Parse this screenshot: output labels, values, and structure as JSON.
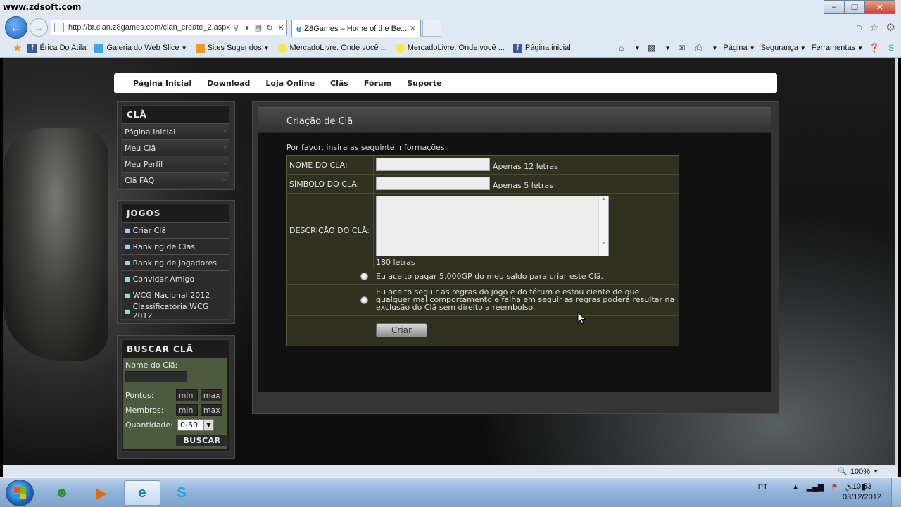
{
  "watermark": "www.zdsoft.com",
  "browser": {
    "url": "http://br.clan.z8games.com/clan_create_2.aspx",
    "tab_title": "Z8Games – Home of the Be...",
    "favorites": [
      {
        "label": "Érica Do Atila",
        "icon": "facebook-icon",
        "dropdown": false
      },
      {
        "label": "Galeria do Web Slice",
        "icon": "webslice-icon",
        "dropdown": true
      },
      {
        "label": "Sites Sugeridos",
        "icon": "suggested-sites-icon",
        "dropdown": true
      },
      {
        "label": "MercadoLivre. Onde você ...",
        "icon": "mercadolivre-icon",
        "dropdown": false
      },
      {
        "label": "MercadoLivre. Onde você ...",
        "icon": "mercadolivre-icon",
        "dropdown": false
      },
      {
        "label": "Página inicial",
        "icon": "facebook-icon",
        "dropdown": false
      }
    ],
    "commands": {
      "page": "Página",
      "safety": "Segurança",
      "tools": "Ferramentas"
    },
    "zoom": "100%"
  },
  "topnav": [
    "Página Inicial",
    "Download",
    "Loja Online",
    "Clãs",
    "Fórum",
    "Suporte"
  ],
  "sidebar": {
    "cla": {
      "title": "CLÃ",
      "items": [
        "Página Inicial",
        "Meu Clã",
        "Meu Perfil",
        "Clã FAQ"
      ]
    },
    "jogos": {
      "title": "JOGOS",
      "items": [
        "Criar Clã",
        "Ranking de Clãs",
        "Ranking de Jogadores",
        "Convidar Amigo",
        "WCG Nacional 2012",
        "Classificatória WCG 2012"
      ]
    },
    "buscar": {
      "title": "BUSCAR CLÃ",
      "nome_label": "Nome do Clã:",
      "pontos_label": "Pontos:",
      "membros_label": "Membros:",
      "quantidade_label": "Quantidade:",
      "min": "min",
      "max": "max",
      "quantidade_value": "0-50",
      "button": "BUSCAR"
    }
  },
  "main": {
    "title": "Criação de Clã",
    "intro": "Por favor, insira as seguinte informações.",
    "nome_label": "NOME DO CLÃ:",
    "nome_hint": "Apenas 12 letras",
    "simbolo_label": "SÍMBOLO DO CLÃ:",
    "simbolo_hint": "Apenas 5 letras",
    "descricao_label": "DESCRIÇÃO DO CLÃ:",
    "descricao_hint": "180 letras",
    "aceite_pagamento": "Eu aceito pagar 5.000GP do meu saldo para criar este Clã.",
    "aceite_regras": "Eu aceito seguir as regras do jogo e do fórum e estou ciente de que qualquer mal comportamento e falha em seguir as regras poderá resultar na exclusão do Clã sem direito a reembolso.",
    "criar_button": "Criar"
  },
  "taskbar": {
    "lang": "PT",
    "time": "10:53",
    "date": "03/12/2012",
    "apps": [
      "people-icon",
      "media-player-icon",
      "internet-explorer-icon",
      "skype-icon"
    ]
  }
}
